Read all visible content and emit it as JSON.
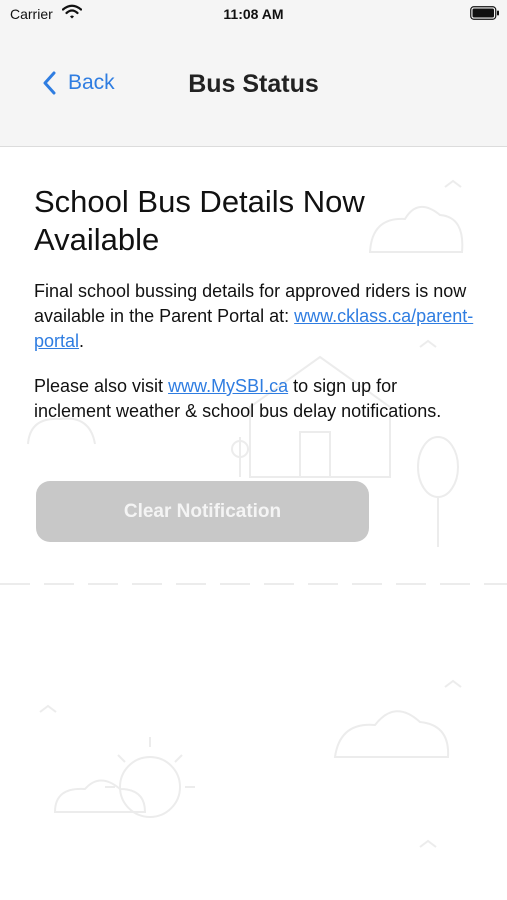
{
  "status_bar": {
    "carrier": "Carrier",
    "time": "11:08 AM"
  },
  "nav": {
    "back_label": "Back",
    "title": "Bus Status"
  },
  "notification": {
    "headline": "School Bus Details Now Available",
    "para1_text": "Final school bussing details for approved riders is now available in the Parent Portal at: ",
    "para1_link": "www.cklass.ca/parent-portal",
    "para1_end": ".",
    "para2_prefix": "Please also visit ",
    "para2_link": "www.MySBI.ca",
    "para2_suffix": " to sign up for inclement weather & school bus delay notifications."
  },
  "actions": {
    "clear_label": "Clear Notification"
  },
  "colors": {
    "link": "#2f7de1",
    "button_disabled": "#c8c8c8",
    "nav_background": "#f5f5f5"
  },
  "icons": [
    "wifi-icon",
    "battery-icon",
    "chevron-left-icon"
  ]
}
